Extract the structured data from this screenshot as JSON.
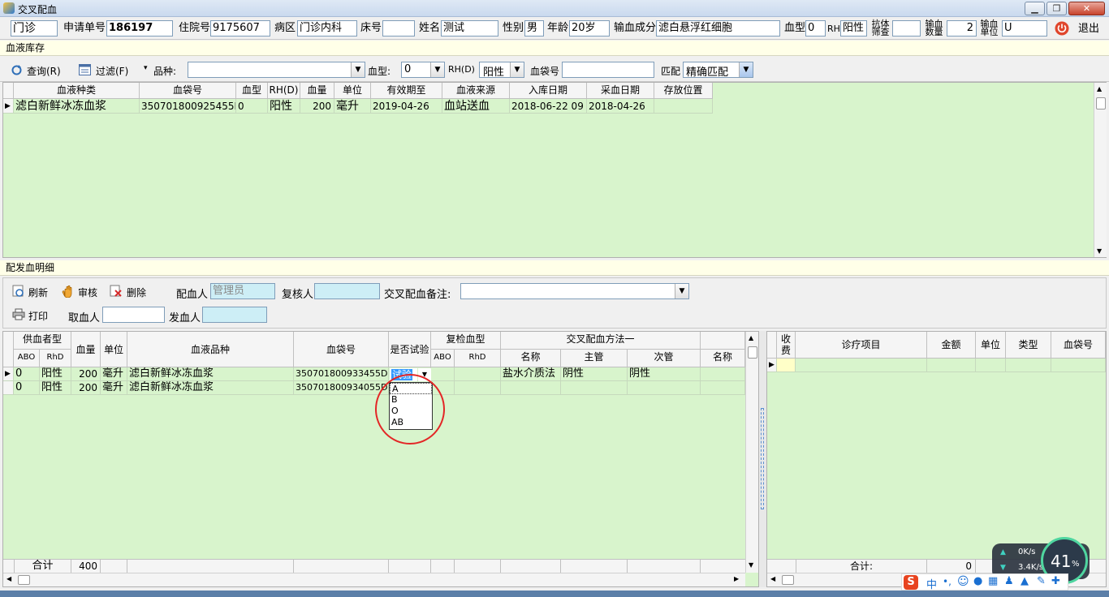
{
  "window": {
    "title": "交叉配血",
    "close_label": "退出"
  },
  "header": {
    "type_value": "门诊",
    "request_no_label": "申请单号",
    "request_no": "186197",
    "admission_no_label": "住院号",
    "admission_no": "9175607",
    "ward_label": "病区",
    "ward": "门诊内科",
    "bed_label": "床号",
    "bed": "",
    "name_label": "姓名",
    "name": "测试",
    "gender_label": "性别",
    "gender": "男",
    "age_label": "年龄",
    "age": "20岁",
    "component_label": "输血成分",
    "component": "滤白悬浮红细胞",
    "blood_type_label": "血型",
    "blood_type": "0",
    "rh_label": "RH",
    "rh": "阳性",
    "antibody_label_1": "抗体",
    "antibody_label_2": "筛查",
    "antibody": "",
    "quantity_label_1": "输血",
    "quantity_label_2": "数量",
    "quantity": "2",
    "unit_label_1": "输血",
    "unit_label_2": "单位",
    "unit": "U"
  },
  "stock": {
    "section_title": "血液库存",
    "query_label": "查询(R)",
    "filter_label": "过滤(F)",
    "variety_label": "品种:",
    "variety": "",
    "blood_type_label": "血型:",
    "blood_type": "0",
    "rh_label": "RH(D)",
    "rh": "阳性",
    "bag_label": "血袋号",
    "bag": "",
    "match_label": "匹配",
    "match": "精确匹配",
    "columns": [
      "血液种类",
      "血袋号",
      "血型",
      "RH(D)",
      "血量",
      "单位",
      "有效期至",
      "血液来源",
      "入库日期",
      "采血日期",
      "存放位置"
    ],
    "rows": [
      [
        "滤白新鲜冰冻血浆",
        "350701800925455D",
        "0",
        "阳性",
        "200",
        "毫升",
        "2019-04-26",
        "血站送血",
        "2018-06-22 09",
        "2018-04-26",
        ""
      ]
    ]
  },
  "detail": {
    "section_title": "配发血明细",
    "refresh_label": "刷新",
    "audit_label": "审核",
    "delete_label": "删除",
    "matcher_label": "配血人",
    "matcher": "管理员",
    "reviewer_label": "复核人",
    "reviewer": "",
    "remark_label": "交叉配血备注:",
    "remark": "",
    "print_label": "打印",
    "taker_label": "取血人",
    "taker": "",
    "issuer_label": "发血人",
    "issuer": "",
    "group_donor": "供血者型",
    "col_abo": "ABO",
    "col_rhd": "RhD",
    "col_volume": "血量",
    "col_unit": "单位",
    "col_variety": "血液品种",
    "col_bag": "血袋号",
    "col_test": "是否试验",
    "group_recheck": "复检血型",
    "col_re_abo": "ABO",
    "col_re_rhd": "RhD",
    "group_method": "交叉配血方法一",
    "col_name": "名称",
    "col_major": "主管",
    "col_minor": "次管",
    "col_name2": "名称",
    "rows": [
      {
        "abo": "0",
        "rhd": "阳性",
        "volume": "200",
        "unit": "毫升",
        "variety": "滤白新鲜冰冻血浆",
        "bag": "350701800933455D",
        "test": "试验",
        "method": "盐水介质法",
        "major": "阴性",
        "minor": "阴性"
      },
      {
        "abo": "0",
        "rhd": "阳性",
        "volume": "200",
        "unit": "毫升",
        "variety": "滤白新鲜冰冻血浆",
        "bag": "350701800934055D",
        "test": "",
        "method": "",
        "major": "",
        "minor": ""
      }
    ],
    "dropdown_options": [
      "A",
      "B",
      "O",
      "AB"
    ],
    "total_label": "合计",
    "total_volume": "400"
  },
  "fees": {
    "col_charged_1": "收",
    "col_charged_2": "费",
    "col_item": "诊疗项目",
    "col_amount": "金额",
    "col_unit": "单位",
    "col_type": "类型",
    "col_bag": "血袋号",
    "total_label": "合计:",
    "total_amount": "0"
  },
  "overlay": {
    "upload_speed": "0K/s",
    "download_speed": "3.4K/s",
    "percent": "41",
    "percent_sign": "%"
  },
  "tray": {
    "ime_label": "中"
  }
}
